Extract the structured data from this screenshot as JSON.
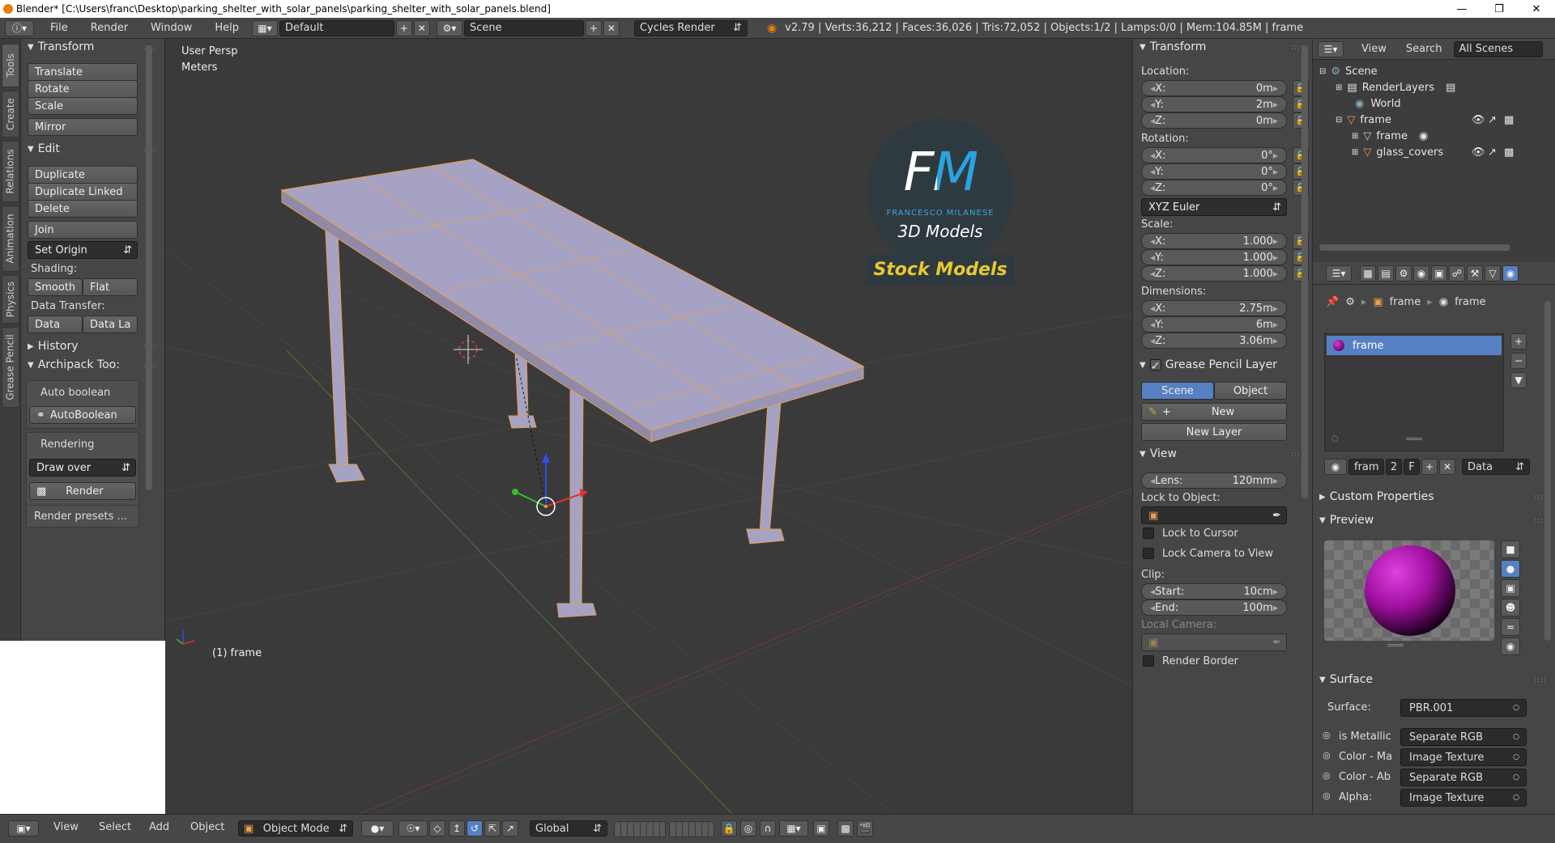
{
  "titlebar": {
    "title": "Blender* [C:\\Users\\franc\\Desktop\\parking_shelter_with_solar_panels\\parking_shelter_with_solar_panels.blend]"
  },
  "infobar": {
    "menus": [
      "File",
      "Render",
      "Window",
      "Help"
    ],
    "screen_layout": "Default",
    "scene": "Scene",
    "engine": "Cycles Render",
    "stats": "v2.79 | Verts:36,212 | Faces:36,026 | Tris:72,052 | Objects:1/2 | Lamps:0/0 | Mem:104.85M | frame"
  },
  "vtabs": [
    "Tools",
    "Create",
    "Relations",
    "Animation",
    "Physics",
    "Grease Pencil"
  ],
  "toolshelf": {
    "transform": {
      "title": "Transform",
      "buttons": [
        "Translate",
        "Rotate",
        "Scale",
        "Mirror"
      ]
    },
    "edit": {
      "title": "Edit",
      "buttons": [
        "Duplicate",
        "Duplicate Linked",
        "Delete",
        "Join"
      ],
      "set_origin": "Set Origin",
      "shading_label": "Shading:",
      "smooth": "Smooth",
      "flat": "Flat",
      "data_transfer_label": "Data Transfer:",
      "data": "Data",
      "data_la": "Data La"
    },
    "history": "History",
    "archipack": {
      "title": "Archipack Too:",
      "auto_boolean_label": "Auto boolean",
      "auto_boolean_btn": "AutoBoolean",
      "rendering_label": "Rendering",
      "draw_over": "Draw over",
      "render_btn": "Render",
      "render_presets": "Render presets ..."
    }
  },
  "viewport": {
    "view_name": "User Persp",
    "units": "Meters",
    "object_label": "(1) frame",
    "logo": {
      "letters": "FM",
      "name": "FRANCESCO MILANESE",
      "sub": "3D Models",
      "banner": "Stock Models"
    }
  },
  "npanel": {
    "transform_title": "Transform",
    "location_label": "Location:",
    "location": [
      {
        "axis": "X:",
        "value": "0m"
      },
      {
        "axis": "Y:",
        "value": "2m"
      },
      {
        "axis": "Z:",
        "value": "0m"
      }
    ],
    "rotation_label": "Rotation:",
    "rotation": [
      {
        "axis": "X:",
        "value": "0°"
      },
      {
        "axis": "Y:",
        "value": "0°"
      },
      {
        "axis": "Z:",
        "value": "0°"
      }
    ],
    "rotation_mode": "XYZ Euler",
    "scale_label": "Scale:",
    "scale": [
      {
        "axis": "X:",
        "value": "1.000"
      },
      {
        "axis": "Y:",
        "value": "1.000"
      },
      {
        "axis": "Z:",
        "value": "1.000"
      }
    ],
    "dimensions_label": "Dimensions:",
    "dimensions": [
      {
        "axis": "X:",
        "value": "2.75m"
      },
      {
        "axis": "Y:",
        "value": "6m"
      },
      {
        "axis": "Z:",
        "value": "3.06m"
      }
    ],
    "grease_pencil_title": "Grease Pencil Layer",
    "gp_scene": "Scene",
    "gp_object": "Object",
    "gp_new": "New",
    "gp_new_layer": "New Layer",
    "view_title": "View",
    "lens_label": "Lens:",
    "lens_value": "120mm",
    "lock_to_object": "Lock to Object:",
    "lock_to_cursor": "Lock to Cursor",
    "lock_camera": "Lock Camera to View",
    "clip_label": "Clip:",
    "clip_start_label": "Start:",
    "clip_start": "10cm",
    "clip_end_label": "End:",
    "clip_end": "100m",
    "local_camera": "Local Camera:",
    "render_border": "Render Border"
  },
  "outliner": {
    "view": "View",
    "search": "Search",
    "filter": "All Scenes",
    "items": [
      {
        "label": "Scene",
        "indent": 0
      },
      {
        "label": "RenderLayers",
        "indent": 1
      },
      {
        "label": "World",
        "indent": 1
      },
      {
        "label": "frame",
        "indent": 1
      },
      {
        "label": "frame",
        "indent": 2
      },
      {
        "label": "glass_covers",
        "indent": 2
      }
    ]
  },
  "properties": {
    "breadcrumb": [
      "frame",
      "frame"
    ],
    "material_slot": "frame",
    "mat_name": "fram",
    "mat_users": "2",
    "mat_fake": "F",
    "data_link": "Data",
    "custom_props": "Custom Properties",
    "preview": "Preview",
    "surface_title": "Surface",
    "surface_label": "Surface:",
    "surface_value": "PBR.001",
    "rows": [
      {
        "label": "is Metallic",
        "value": "Separate RGB"
      },
      {
        "label": "Color - Ma",
        "value": "Image Texture"
      },
      {
        "label": "Color - Ab",
        "value": "Separate RGB"
      },
      {
        "label": "Alpha:",
        "value": "Image Texture"
      }
    ]
  },
  "bottombar": {
    "menus": [
      "View",
      "Select",
      "Add",
      "Object"
    ],
    "mode": "Object Mode",
    "orientation": "Global"
  },
  "colors": {
    "bg_panel": "#464646",
    "viewport": "#3a3a3a",
    "accent_blue": "#5680c2",
    "selection_orange": "#e8a050",
    "mesh": "#a6a2c4"
  }
}
